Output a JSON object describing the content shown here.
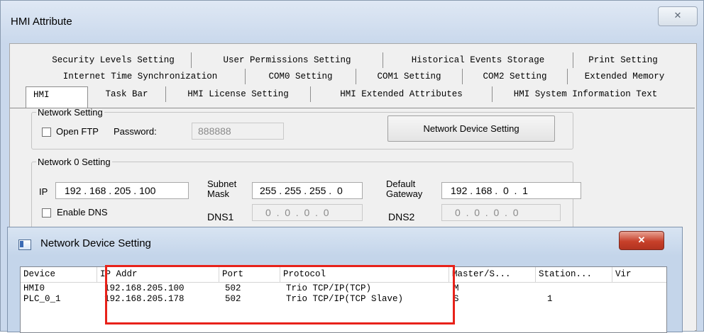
{
  "window": {
    "title": "HMI Attribute",
    "close_glyph": "✕"
  },
  "tabs": {
    "row1": [
      "Security Levels Setting",
      "User Permissions Setting",
      "Historical Events Storage",
      "Print Setting"
    ],
    "row2": [
      "Internet Time Synchronization",
      "COM0 Setting",
      "COM1 Setting",
      "COM2 Setting",
      "Extended Memory"
    ],
    "row3": [
      "HMI",
      "Task Bar",
      "HMI License Setting",
      "HMI Extended Attributes",
      "HMI System Information Text"
    ],
    "active": "HMI"
  },
  "network_setting": {
    "legend": "Network Setting",
    "open_ftp_label": "Open FTP",
    "password_label": "Password:",
    "password_value": "888888",
    "open_ftp_checked": false,
    "device_button": "Network Device Setting"
  },
  "network0": {
    "legend": "Network 0 Setting",
    "ip_label": "IP",
    "ip_value": "192 . 168 . 205 . 100",
    "subnet_label_1": "Subnet",
    "subnet_label_2": "Mask",
    "subnet_value": "255 . 255 . 255 .  0",
    "gateway_label_1": "Default",
    "gateway_label_2": "Gateway",
    "gateway_value": "192 . 168 .  0  .  1",
    "enable_dns_label": "Enable DNS",
    "enable_dns_checked": false,
    "dns1_label": "DNS1",
    "dns1_value": "0  .  0  .  0  .  0",
    "dns2_label": "DNS2",
    "dns2_value": "0  .  0  .  0  .  0"
  },
  "dialog": {
    "title": "Network Device Setting",
    "close_glyph": "✕",
    "columns": [
      "Device",
      "IP Addr",
      "Port",
      "Protocol",
      "Master/S...",
      "Station...",
      "Vir"
    ],
    "rows": [
      [
        "HMI0",
        "192.168.205.100",
        "502",
        "Trio TCP/IP(TCP)",
        "M",
        "",
        ""
      ],
      [
        "PLC_0_1",
        "192.168.205.178",
        "502",
        "Trio TCP/IP(TCP Slave)",
        "S",
        "1",
        ""
      ]
    ]
  },
  "colors": {
    "highlight": "#e8221a",
    "close_button": "#c7402a"
  }
}
